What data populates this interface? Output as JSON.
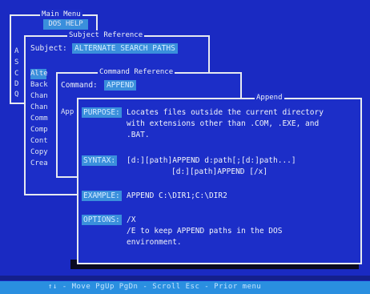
{
  "main_menu": {
    "title": "Main Menu",
    "selected": "DOS HELP",
    "edge_letters": [
      "A",
      "S",
      "C",
      "D",
      "Q"
    ]
  },
  "subject_reference": {
    "title": "Subject Reference",
    "subject_label": "Subject:",
    "subject_value": "ALTERNATE SEARCH PATHS",
    "items": [
      "Alte",
      "Back",
      "Chan",
      "Chan",
      "Comm",
      "Comp",
      "Cont",
      "Copy",
      "Crea"
    ]
  },
  "command_reference": {
    "title": "Command Reference",
    "command_label": "Command:",
    "command_value": "APPEND",
    "item": "App"
  },
  "append": {
    "title": "Append",
    "purpose_label": "PURPOSE:",
    "purpose_lines": [
      "Locates files outside the current directory",
      "with extensions other than .COM, .EXE, and",
      ".BAT."
    ],
    "syntax_label": "SYNTAX:",
    "syntax_lines": [
      "[d:][path]APPEND d:path[;[d:]path...]",
      "[d:][path]APPEND [/x]"
    ],
    "example_label": "EXAMPLE:",
    "example_text": "APPEND C:\\DIR1;C:\\DIR2",
    "options_label": "OPTIONS:",
    "options_lines": [
      "/X",
      "/E to keep APPEND paths in the DOS",
      "environment."
    ]
  },
  "status_bar": {
    "text": "↑↓ - Move   PgUp PgDn - Scroll   Esc - Prior menu"
  },
  "colors": {
    "background": "#1a2ac2",
    "highlight": "#3a8fdc",
    "border": "#e6e9f0",
    "status": "#2a8fe0"
  }
}
